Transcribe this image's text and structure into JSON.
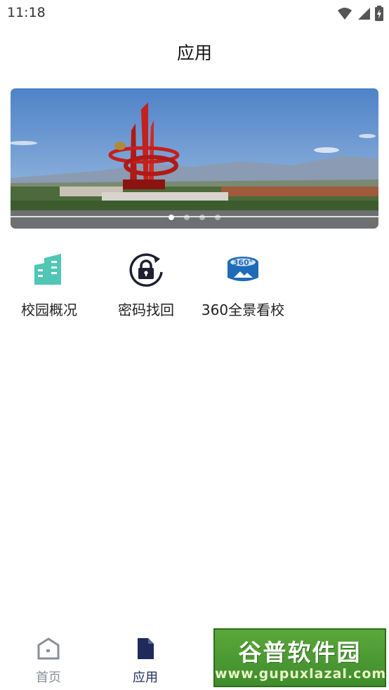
{
  "status_bar": {
    "time": "11:18"
  },
  "header": {
    "title": "应用"
  },
  "banner": {
    "page_count": 4,
    "active_index": 0
  },
  "apps": [
    {
      "label": "校园概况",
      "icon": "building-icon",
      "color": "#4fc7b4"
    },
    {
      "label": "密码找回",
      "icon": "lock-refresh-icon",
      "color": "#1f1f33"
    },
    {
      "label": "360全景看校",
      "icon": "panorama-360-icon",
      "color": "#1e6bb8"
    }
  ],
  "tabbar": {
    "home_label": "首页",
    "apps_label": "应用"
  },
  "watermark": {
    "title": "谷普软件园",
    "url": "www.gupuxlazal.com"
  },
  "colors": {
    "tab_active": "#1f2a5a",
    "tab_inactive": "#8a8f99"
  }
}
